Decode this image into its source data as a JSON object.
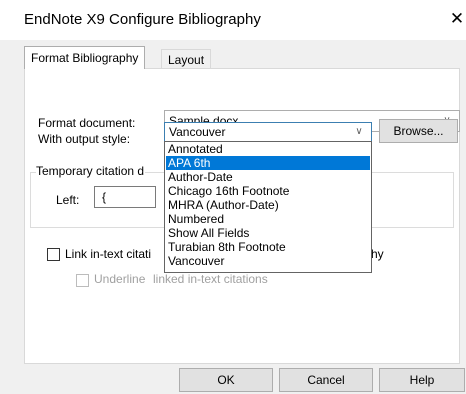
{
  "window": {
    "title": "EndNote X9 Configure Bibliography",
    "close_glyph": "✕"
  },
  "tabs": [
    {
      "label": "Format Bibliography",
      "active": true
    },
    {
      "label": "Layout",
      "active": false
    }
  ],
  "format_document": {
    "label": "Format document:",
    "value": "Sample.docx"
  },
  "output_style": {
    "label": "With output style:",
    "value": "Vancouver",
    "browse_label": "Browse...",
    "options": [
      "Annotated",
      "APA 6th",
      "Author-Date",
      "Chicago 16th Footnote",
      "MHRA (Author-Date)",
      "Numbered",
      "Show All Fields",
      "Turabian 8th Footnote",
      "Vancouver"
    ],
    "highlighted_option": "APA 6th"
  },
  "temporary_citation": {
    "group_label_visible": "Temporary citation d",
    "left_label": "Left:",
    "left_value": "{"
  },
  "link_citations": {
    "label_visible_start": "Link in-text citati",
    "label_visible_end": "hy",
    "checked": false
  },
  "underline_citations": {
    "label_visible": "linked in-text citations",
    "checked": false,
    "enabled": false
  },
  "footer": {
    "ok_label": "OK",
    "cancel_label": "Cancel",
    "help_label": "Help"
  },
  "colors": {
    "selection": "#0078d7",
    "dialog_bg": "#f0f0f0",
    "focus_border": "#3c7fb1"
  }
}
